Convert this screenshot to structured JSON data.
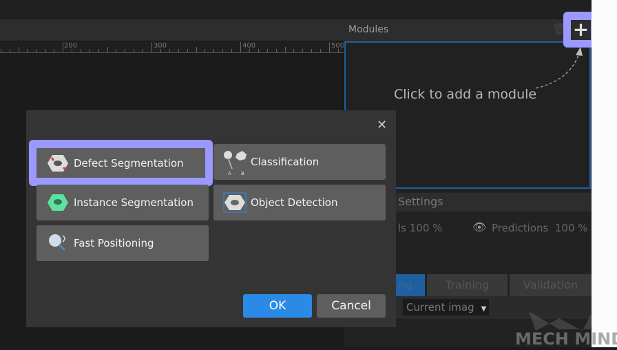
{
  "ruler": {
    "labels": [
      "200",
      "300",
      "400",
      "500"
    ]
  },
  "modules_panel": {
    "title": "Modules",
    "hint": "Click to add a module",
    "add_icon": "plus-icon",
    "delete_icon": "trash-icon"
  },
  "settings": {
    "title": "Settings",
    "labels_text": "ls  100 %",
    "predictions_label": "Predictions",
    "predictions_value": "100 %"
  },
  "tabs": [
    {
      "label": "ng"
    },
    {
      "label": "Training"
    },
    {
      "label": "Validation"
    }
  ],
  "dropdown": {
    "value": "Current imag"
  },
  "logo": "MECH MIND",
  "dialog": {
    "modules": [
      {
        "label": "Defect Segmentation",
        "icon": "defect-nut-icon"
      },
      {
        "label": "Classification",
        "icon": "classification-icon"
      },
      {
        "label": "Instance Segmentation",
        "icon": "green-nut-icon"
      },
      {
        "label": "Object Detection",
        "icon": "detection-nut-icon"
      },
      {
        "label": "Fast Positioning",
        "icon": "magnifier-icon"
      }
    ],
    "ok": "OK",
    "cancel": "Cancel"
  },
  "colors": {
    "highlight": "#9b98ff",
    "accent": "#2a8ae6",
    "module_border": "#1e5fa0"
  }
}
